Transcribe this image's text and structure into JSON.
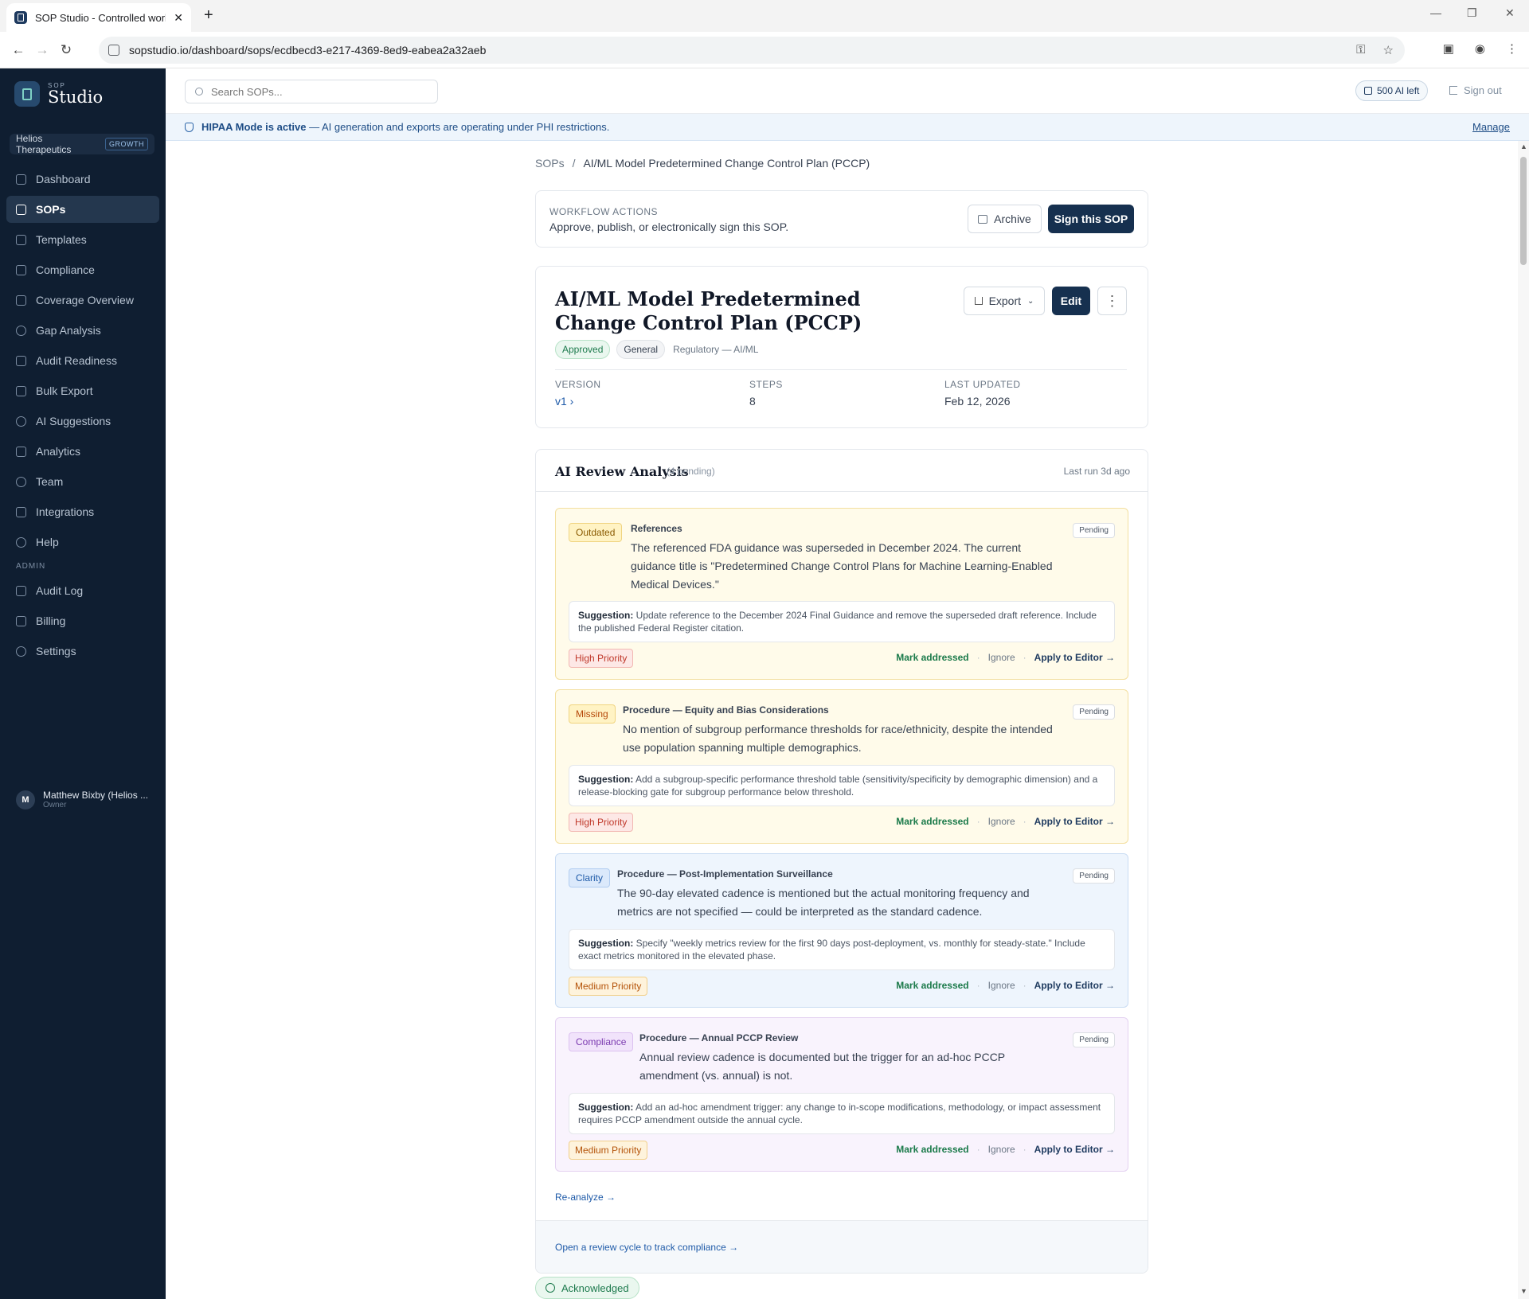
{
  "browser": {
    "tab_title": "SOP Studio - Controlled workflo",
    "url": "sopstudio.io/dashboard/sops/ecdbecd3-e217-4369-8ed9-eabea2a32aeb"
  },
  "brand": {
    "small": "SOP",
    "big": "Studio"
  },
  "org": {
    "name": "Helios Therapeutics",
    "plan": "GROWTH"
  },
  "nav": {
    "items": [
      {
        "label": "Dashboard",
        "icon": "home-icon"
      },
      {
        "label": "SOPs",
        "icon": "document-icon",
        "active": true
      },
      {
        "label": "Templates",
        "icon": "template-icon"
      },
      {
        "label": "Compliance",
        "icon": "checklist-icon"
      },
      {
        "label": "Coverage Overview",
        "icon": "grid-icon"
      },
      {
        "label": "Gap Analysis",
        "icon": "target-icon"
      },
      {
        "label": "Audit Readiness",
        "icon": "shield-icon"
      },
      {
        "label": "Bulk Export",
        "icon": "download-icon"
      },
      {
        "label": "AI Suggestions",
        "icon": "sparkle-icon"
      },
      {
        "label": "Analytics",
        "icon": "bar-chart-icon"
      },
      {
        "label": "Team",
        "icon": "users-icon"
      },
      {
        "label": "Integrations",
        "icon": "external-link-icon"
      },
      {
        "label": "Help",
        "icon": "help-icon"
      }
    ],
    "admin_label": "ADMIN",
    "admin_items": [
      {
        "label": "Audit Log",
        "icon": "shield-icon"
      },
      {
        "label": "Billing",
        "icon": "credit-card-icon"
      },
      {
        "label": "Settings",
        "icon": "gear-icon"
      }
    ]
  },
  "user": {
    "initial": "M",
    "name": "Matthew Bixby (Helios ...",
    "role": "Owner"
  },
  "topbar": {
    "search_placeholder": "Search SOPs...",
    "ai_left": "500 AI left",
    "sign_out": "Sign out"
  },
  "hipaa": {
    "title": "HIPAA Mode is active",
    "text": " — AI generation and exports are operating under PHI restrictions.",
    "manage": "Manage"
  },
  "breadcrumb": {
    "root": "SOPs",
    "sep": "/",
    "current": "AI/ML Model Predetermined Change Control Plan (PCCP)"
  },
  "workflow": {
    "label": "WORKFLOW ACTIONS",
    "desc": "Approve, publish, or electronically sign this SOP.",
    "archive": "Archive",
    "sign": "Sign this SOP"
  },
  "doc": {
    "title": "AI/ML Model Predetermined Change Control Plan (PCCP)",
    "status": "Approved",
    "type": "General",
    "category": "Regulatory — AI/ML",
    "export": "Export",
    "edit": "Edit",
    "version_label": "VERSION",
    "version": "v1 ›",
    "steps_label": "STEPS",
    "steps": "8",
    "updated_label": "LAST UPDATED",
    "updated": "Feb 12, 2026"
  },
  "review": {
    "title": "AI Review Analysis",
    "pending": "(4 pending)",
    "last_run": "Last run 3d ago",
    "issues": [
      {
        "tag": "Outdated",
        "section": "References",
        "text": "The referenced FDA guidance was superseded in December 2024. The current guidance title is \"Predetermined Change Control Plans for Machine Learning-Enabled Medical Devices.\"",
        "status": "Pending",
        "suggestion_label": "Suggestion:",
        "suggestion": " Update reference to the December 2024 Final Guidance and remove the superseded draft reference. Include the published Federal Register citation.",
        "priority": "High Priority"
      },
      {
        "tag": "Missing",
        "section": "Procedure — Equity and Bias Considerations",
        "text": "No mention of subgroup performance thresholds for race/ethnicity, despite the intended use population spanning multiple demographics.",
        "status": "Pending",
        "suggestion_label": "Suggestion:",
        "suggestion": " Add a subgroup-specific performance threshold table (sensitivity/specificity by demographic dimension) and a release-blocking gate for subgroup performance below threshold.",
        "priority": "High Priority"
      },
      {
        "tag": "Clarity",
        "section": "Procedure — Post-Implementation Surveillance",
        "text": "The 90-day elevated cadence is mentioned but the actual monitoring frequency and metrics are not specified — could be interpreted as the standard cadence.",
        "status": "Pending",
        "suggestion_label": "Suggestion:",
        "suggestion": " Specify \"weekly metrics review for the first 90 days post-deployment, vs. monthly for steady-state.\" Include exact metrics monitored in the elevated phase.",
        "priority": "Medium Priority"
      },
      {
        "tag": "Compliance",
        "section": "Procedure — Annual PCCP Review",
        "text": "Annual review cadence is documented but the trigger for an ad-hoc PCCP amendment (vs. annual) is not.",
        "status": "Pending",
        "suggestion_label": "Suggestion:",
        "suggestion": " Add an ad-hoc amendment trigger: any change to in-scope modifications, methodology, or impact assessment requires PCCP amendment outside the annual cycle.",
        "priority": "Medium Priority"
      }
    ],
    "actions": {
      "addressed": "Mark addressed",
      "dot": "·",
      "ignore": "Ignore",
      "apply": "Apply to Editor →"
    },
    "reanalyze": "Re-analyze →",
    "open_cycle": "Open a review cycle to track compliance →"
  },
  "acknowledged": "Acknowledged"
}
